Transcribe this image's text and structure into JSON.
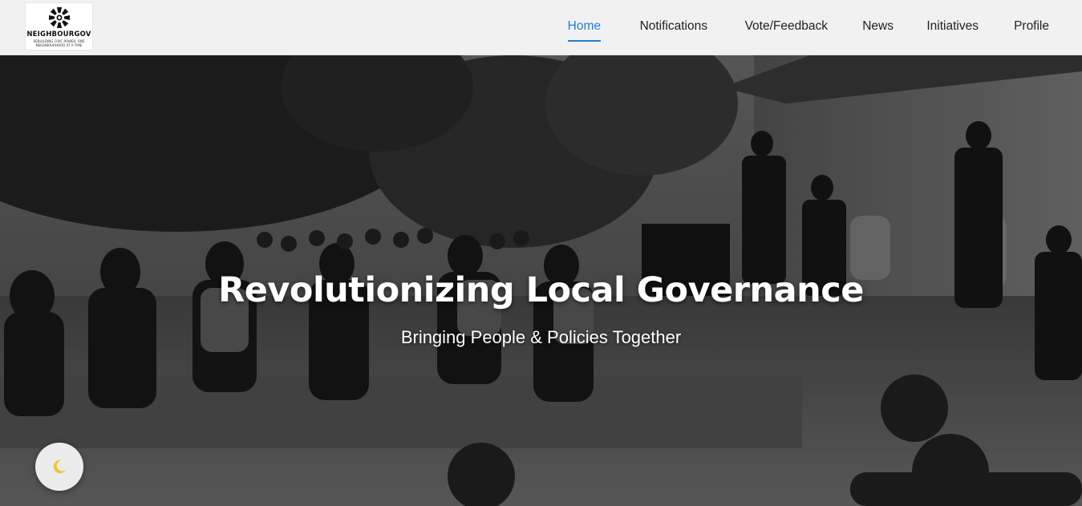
{
  "brand": {
    "name": "NEIGHBOURGOV",
    "tagline": "REBUILDING CIVIC POWER, ONE NEIGHBOURHOOD AT A TIME",
    "logo_icon": "sunburst-logo-icon"
  },
  "nav": {
    "items": [
      {
        "label": "Home",
        "active": true
      },
      {
        "label": "Notifications",
        "active": false
      },
      {
        "label": "Vote/Feedback",
        "active": false
      },
      {
        "label": "News",
        "active": false
      },
      {
        "label": "Initiatives",
        "active": false
      },
      {
        "label": "Profile",
        "active": false
      }
    ]
  },
  "hero": {
    "title": "Revolutionizing Local Governance",
    "subtitle": "Bringing People & Policies Together"
  },
  "theme_toggle": {
    "icon": "moon-icon"
  },
  "colors": {
    "accent": "#1f7fd6",
    "header_bg": "#f1f1f1",
    "moon": "#f4c430"
  }
}
